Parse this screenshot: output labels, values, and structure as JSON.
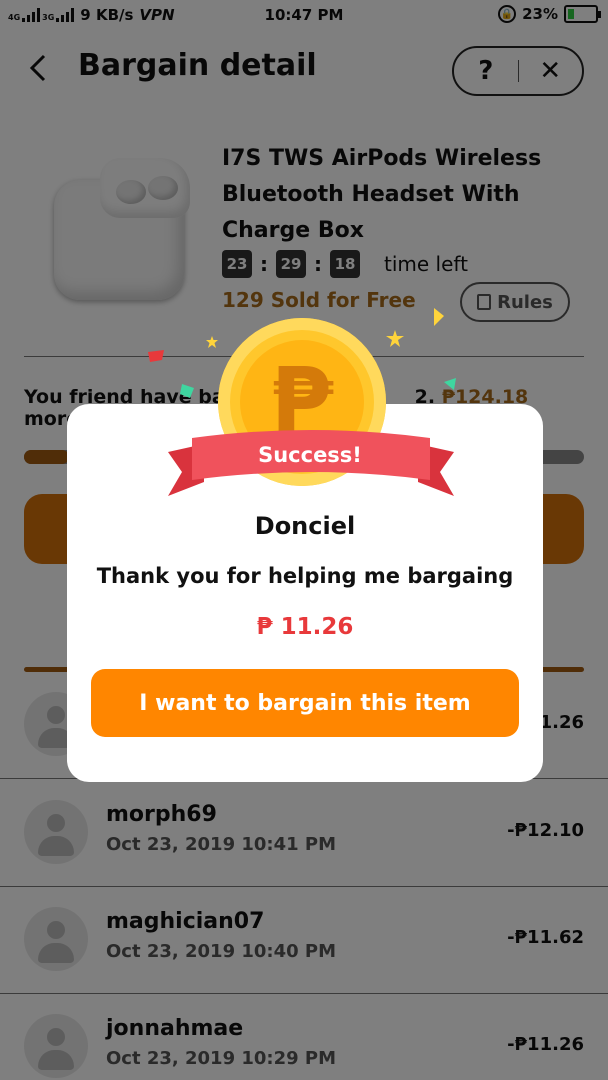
{
  "status_bar": {
    "net_4g": "4G",
    "net_3g": "3G",
    "speed": "9 KB/s",
    "vpn": "VPN",
    "time": "10:47 PM",
    "battery": "23%",
    "battery_level": 0.23
  },
  "header": {
    "title": "Bargain detail",
    "help": "?",
    "close": "✕"
  },
  "product": {
    "title": "I7S TWS AirPods Wireless Bluetooth Headset With Charge Box",
    "timer": [
      "23",
      "29",
      "18"
    ],
    "time_left": "time left",
    "sold": "129 Sold for Free",
    "rules": "Rules"
  },
  "progress": {
    "text_start": "You friend have ba",
    "text_mid": "2. ",
    "amount": "₱124.18",
    "text_end": " more to go.",
    "fraction": 0.08
  },
  "helpers": [
    {
      "name": "",
      "date": "",
      "amount": "11.26"
    },
    {
      "name": "morph69",
      "date": "Oct 23, 2019 10:41 PM",
      "amount": "-₱12.10"
    },
    {
      "name": "maghician07",
      "date": "Oct 23, 2019 10:40 PM",
      "amount": "-₱11.62"
    },
    {
      "name": "jonnahmae",
      "date": "Oct 23, 2019 10:29 PM",
      "amount": "-₱11.26"
    }
  ],
  "modal": {
    "coin_symbol": "₱",
    "ribbon": "Success!",
    "name": "Donciel",
    "thanks": "Thank you for helping me bargaing",
    "amount": "₱ 11.26",
    "button": "I want to bargain this item"
  },
  "colors": {
    "accent_orange": "#ff8600",
    "amount_red": "#e8393b",
    "ribbon_red": "#f0525c",
    "coin_gold": "#ffc72c"
  }
}
